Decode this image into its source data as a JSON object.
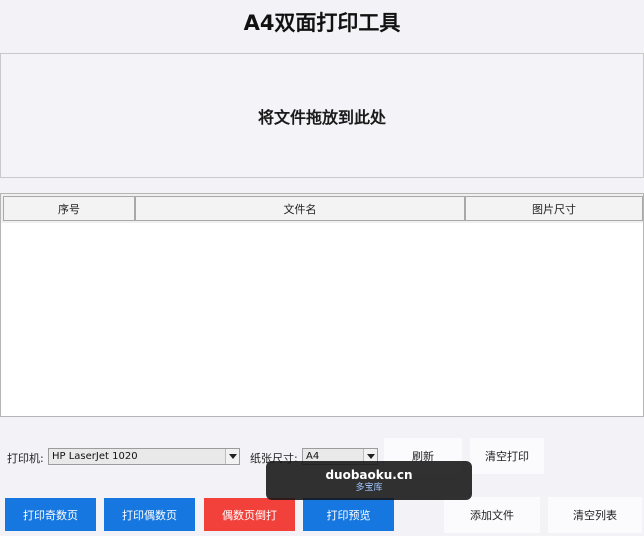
{
  "app": {
    "title": "A4双面打印工具"
  },
  "drop_zone": {
    "hint": "将文件拖放到此处"
  },
  "table": {
    "columns": [
      "序号",
      "文件名",
      "图片尺寸"
    ],
    "rows": []
  },
  "toolbar": {
    "printer_label": "打印机:",
    "printer_value": "HP LaserJet 1020",
    "paper_label": "纸张尺寸:",
    "paper_value": "A4",
    "refresh_label": "刷新",
    "clear_print_label": "清空打印"
  },
  "actions": {
    "print_odd": "打印奇数页",
    "print_even": "打印偶数页",
    "even_reverse": "偶数页倒打",
    "print_preview": "打印预览",
    "add_file": "添加文件",
    "clear_list": "清空列表"
  },
  "watermark": {
    "line1": "duobaoku.cn",
    "line2": "多宝库"
  },
  "colors": {
    "primary": "#1677e0",
    "danger": "#f2413b",
    "background": "#f3f2f7"
  }
}
